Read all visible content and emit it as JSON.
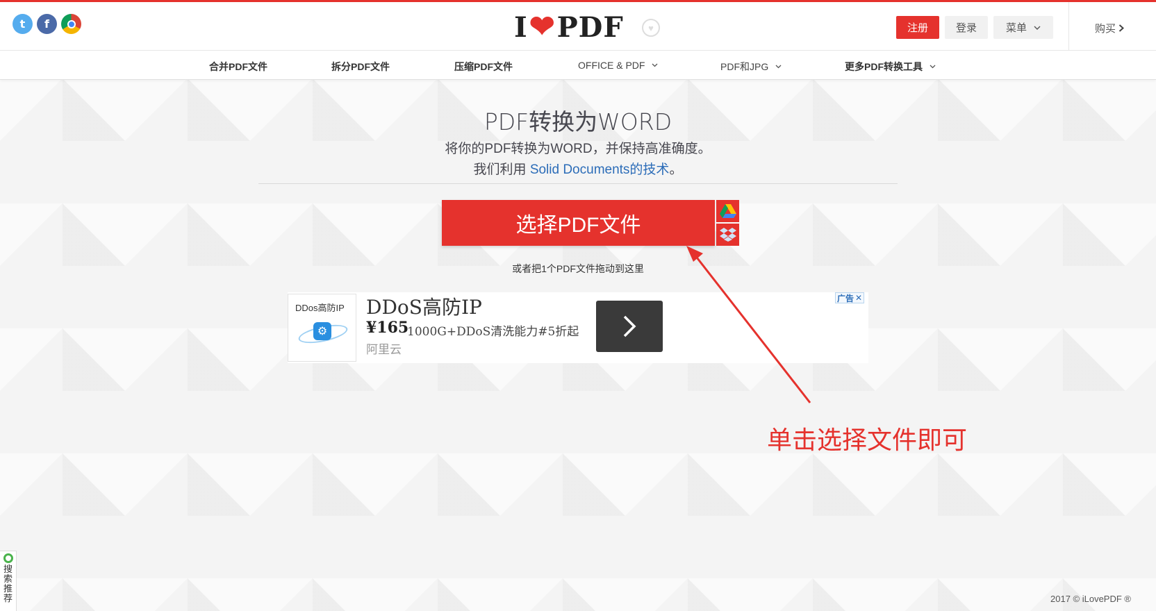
{
  "header": {
    "social": [
      {
        "name": "twitter-icon",
        "glyph": "t"
      },
      {
        "name": "facebook-icon",
        "glyph": "f"
      },
      {
        "name": "chrome-icon",
        "glyph": ""
      }
    ],
    "logo_left": "I",
    "logo_right": "PDF",
    "register_label": "注册",
    "login_label": "登录",
    "menu_label": "菜单",
    "buy_label": "购买"
  },
  "nav": [
    {
      "label": "合并PDF文件",
      "dropdown": false
    },
    {
      "label": "拆分PDF文件",
      "dropdown": false
    },
    {
      "label": "压缩PDF文件",
      "dropdown": false
    },
    {
      "label": "OFFICE & PDF",
      "dropdown": true
    },
    {
      "label": "PDF和JPG",
      "dropdown": true
    },
    {
      "label": "更多PDF转换工具",
      "dropdown": true
    }
  ],
  "main": {
    "title": "PDF转换为WORD",
    "subtitle": "将你的PDF转换为WORD，并保持高准确度。",
    "subtitle2_prefix": "我们利用 ",
    "subtitle2_link": "Solid Documents的技术",
    "subtitle2_suffix": "。",
    "select_button": "选择PDF文件",
    "drop_hint": "或者把1个PDF文件拖动到这里"
  },
  "ad": {
    "thumb_label": "DDos高防IP",
    "title": "DDoS高防IP",
    "price": "¥165",
    "desc": "1000G+DDoS清洗能力#5折起",
    "brand": "阿里云",
    "badge_label": "广告",
    "badge_close": "✕"
  },
  "annotation": "单击选择文件即可",
  "side_widget": "搜索推荐",
  "footer": "2017 © iLovePDF ®",
  "colors": {
    "brand_red": "#e5322d",
    "link_blue": "#2b6cb8"
  }
}
